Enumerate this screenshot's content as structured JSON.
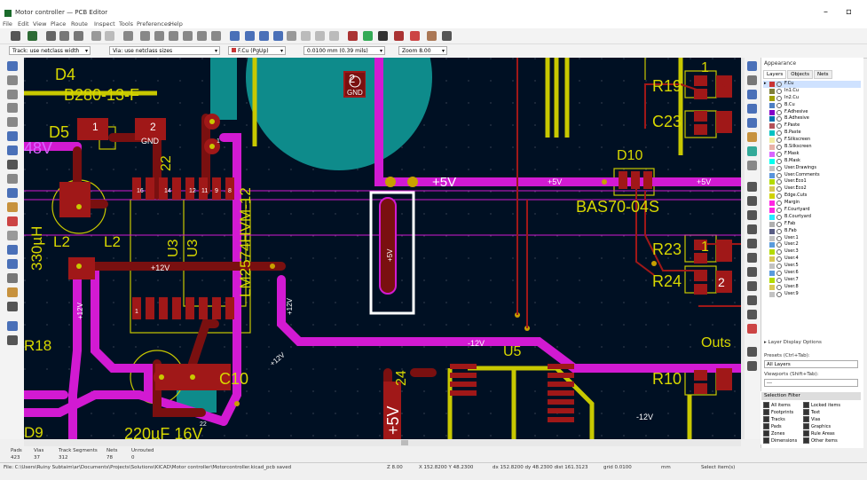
{
  "window": {
    "title": "Motor controller — PCB Editor",
    "min_glyph": "–",
    "max_glyph": "▫"
  },
  "menu": [
    "File",
    "Edit",
    "View",
    "Place",
    "Route",
    "Inspect",
    "Tools",
    "Preferences",
    "Help"
  ],
  "toolbar2": {
    "track_width": "Track: use netclass width",
    "via_size": "Via: use netclass sizes",
    "layer": "F.Cu (PgUp)",
    "grid": "0.0100 mm (0.39 mils)",
    "zoom": "Zoom 8.00"
  },
  "appearance": {
    "title": "Appearance",
    "tabs": [
      "Layers",
      "Objects",
      "Nets"
    ],
    "layers": [
      {
        "name": "F.Cu",
        "color": "#c83434",
        "selected": true
      },
      {
        "name": "In1.Cu",
        "color": "#7f7f38"
      },
      {
        "name": "In2.Cu",
        "color": "#a0a000"
      },
      {
        "name": "B.Cu",
        "color": "#4d7fc4"
      },
      {
        "name": "F.Adhesive",
        "color": "#8400c8"
      },
      {
        "name": "B.Adhesive",
        "color": "#0070b0"
      },
      {
        "name": "F.Paste",
        "color": "#b45058"
      },
      {
        "name": "B.Paste",
        "color": "#00c2c2"
      },
      {
        "name": "F.Silkscreen",
        "color": "#f2eda1"
      },
      {
        "name": "B.Silkscreen",
        "color": "#e8b2a7"
      },
      {
        "name": "F.Mask",
        "color": "#d864ff"
      },
      {
        "name": "B.Mask",
        "color": "#02ffee"
      },
      {
        "name": "User.Drawings",
        "color": "#c2c2c2"
      },
      {
        "name": "User.Comments",
        "color": "#5994dc"
      },
      {
        "name": "User.Eco1",
        "color": "#b4db00"
      },
      {
        "name": "User.Eco2",
        "color": "#d8c852"
      },
      {
        "name": "Edge.Cuts",
        "color": "#d0d200"
      },
      {
        "name": "Margin",
        "color": "#ff26e2"
      },
      {
        "name": "F.Courtyard",
        "color": "#ff26e2"
      },
      {
        "name": "B.Courtyard",
        "color": "#26e9ff"
      },
      {
        "name": "F.Fab",
        "color": "#afafaf"
      },
      {
        "name": "B.Fab",
        "color": "#585d84"
      },
      {
        "name": "User.1",
        "color": "#c2c2c2"
      },
      {
        "name": "User.2",
        "color": "#599bdc"
      },
      {
        "name": "User.3",
        "color": "#b4db00"
      },
      {
        "name": "User.4",
        "color": "#d8c852"
      },
      {
        "name": "User.5",
        "color": "#c2c2c2"
      },
      {
        "name": "User.6",
        "color": "#599bdc"
      },
      {
        "name": "User.7",
        "color": "#b4db00"
      },
      {
        "name": "User.8",
        "color": "#d8c852"
      },
      {
        "name": "User.9",
        "color": "#c2c2c2"
      }
    ],
    "layer_display_options": "▸ Layer Display Options",
    "presets_label": "Presets (Ctrl+Tab):",
    "presets_value": "All Layers",
    "viewports_label": "Viewports (Shift+Tab):",
    "viewports_value": "---"
  },
  "selection_filter": {
    "title": "Selection Filter",
    "items": [
      {
        "label": "All items",
        "checked": true
      },
      {
        "label": "Locked items",
        "checked": true
      },
      {
        "label": "Footprints",
        "checked": true
      },
      {
        "label": "Text",
        "checked": true
      },
      {
        "label": "Tracks",
        "checked": true
      },
      {
        "label": "Vias",
        "checked": true
      },
      {
        "label": "Pads",
        "checked": true
      },
      {
        "label": "Graphics",
        "checked": true
      },
      {
        "label": "Zones",
        "checked": true
      },
      {
        "label": "Rule Areas",
        "checked": true
      },
      {
        "label": "Dimensions",
        "checked": true
      },
      {
        "label": "Other items",
        "checked": true
      }
    ]
  },
  "message_panel": [
    {
      "label": "Pads",
      "value": "423"
    },
    {
      "label": "Vias",
      "value": "37"
    },
    {
      "label": "Track Segments",
      "value": "312"
    },
    {
      "label": "Nets",
      "value": "78"
    },
    {
      "label": "Unrouted",
      "value": "0"
    }
  ],
  "status": {
    "file": "File: C:\\Users\\Ruiny Subtaim\\ar\\Documents\\Projects\\Solutions\\KICAD\\Motor controller\\Motorcontroller.kicad_pcb saved",
    "zoom": "Z 8.00",
    "xy": "X 152.8200  Y 48.2300",
    "dxy": "dx 152.8200  dy 48.2300  dist 161.3123",
    "grid": "grid 0.0100",
    "units": "mm",
    "mode": "Select item(s)"
  },
  "pcb_labels": {
    "d4": "D4",
    "b280": "B280-13-F",
    "d5": "D5",
    "v48": "48V",
    "pad2gnd": "GND",
    "pad2num": "2",
    "pad1num": "1",
    "u3a": "U3",
    "u3b": "U3",
    "lm": "LM2574HVM-12",
    "l2": "L2",
    "l2b": "L2",
    "uh330": "330µH",
    "n22": "22",
    "n12v": "+12V",
    "n12v_left": "+12V",
    "n12v_vert": "+12V",
    "n12v_top": "+12V",
    "r18": "R18",
    "c10": "C10",
    "cap220": "220µF 16V",
    "d9": "D9",
    "v5": "+5V",
    "v5a": "+5V",
    "v5b": "+5V",
    "v5pad": "+5V",
    "v5big": "+5V",
    "d10": "D10",
    "bas70": "BAS70-04S",
    "r19": "R19",
    "c23": "C23",
    "r23": "R23",
    "r24": "R24",
    "r10": "R10",
    "u5": "U5",
    "m12v": "-12V",
    "m12v2": "-12V",
    "v24": "24",
    "gnd_top": "GND",
    "pad_gnd_circle": "2",
    "outs": "Outs",
    "n1a": "1",
    "n1b": "1",
    "n1c": "1",
    "n2c": "2",
    "n1d": "1",
    "n8": "8",
    "n9": "9",
    "n11": "11",
    "n12": "12",
    "n14": "14",
    "n16": "16",
    "n22b": "22"
  }
}
